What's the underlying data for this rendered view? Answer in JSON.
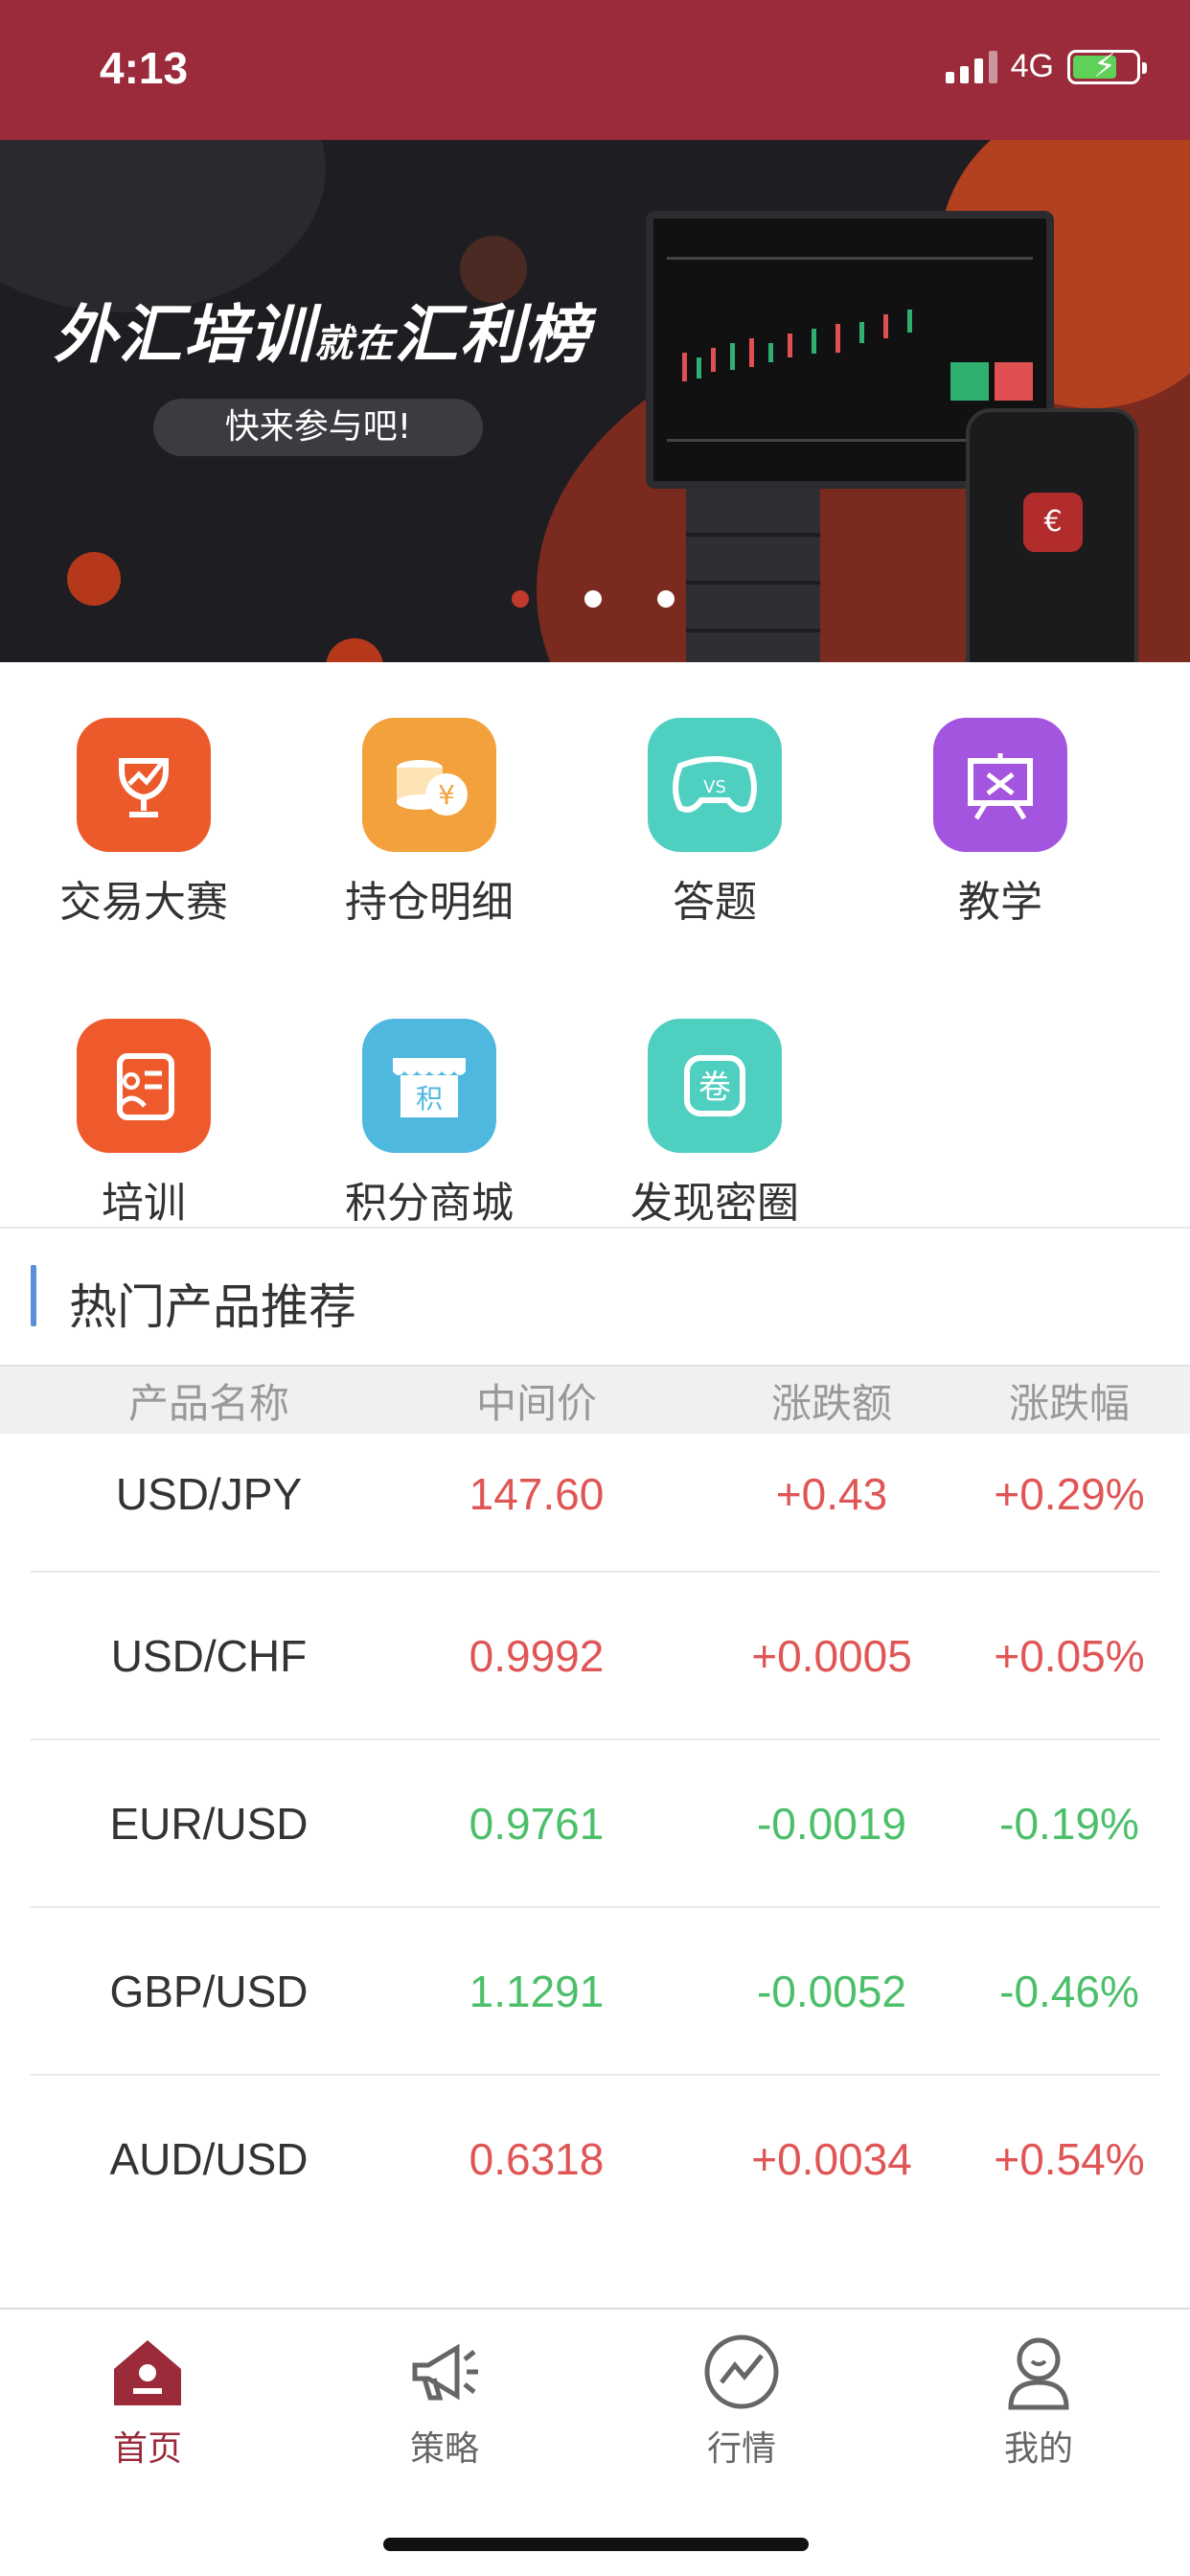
{
  "status_bar": {
    "time": "4:13",
    "network": "4G"
  },
  "banner": {
    "title_part1": "外汇培训",
    "title_small": "就在",
    "title_part2": "汇利榜",
    "pill_text": "快来参与吧!",
    "page_count": 3,
    "active_index": 0
  },
  "menu": {
    "items": [
      {
        "label": "交易大赛",
        "icon": "trophy-chart-icon",
        "color": "#ec5a2c"
      },
      {
        "label": "持仓明细",
        "icon": "coins-yen-icon",
        "color": "#f3a13c"
      },
      {
        "label": "答题",
        "icon": "gamepad-vs-icon",
        "color": "#4fcfc0"
      },
      {
        "label": "教学",
        "icon": "presentation-board-icon",
        "color": "#a355e0"
      },
      {
        "label": "培训",
        "icon": "certificate-icon",
        "color": "#ee5a2c"
      },
      {
        "label": "积分商城",
        "icon": "store-points-icon",
        "color": "#4fb8de"
      },
      {
        "label": "发现密圈",
        "icon": "circle-scroll-icon",
        "color": "#4fcfc0"
      }
    ]
  },
  "section": {
    "title": "热门产品推荐"
  },
  "table": {
    "headers": [
      "产品名称",
      "中间价",
      "涨跌额",
      "涨跌幅"
    ],
    "rows": [
      {
        "name": "USD/JPY",
        "mid": "147.60",
        "change": "+0.43",
        "pct": "+0.29%",
        "trend": "up"
      },
      {
        "name": "USD/CHF",
        "mid": "0.9992",
        "change": "+0.0005",
        "pct": "+0.05%",
        "trend": "up"
      },
      {
        "name": "EUR/USD",
        "mid": "0.9761",
        "change": "-0.0019",
        "pct": "-0.19%",
        "trend": "down"
      },
      {
        "name": "GBP/USD",
        "mid": "1.1291",
        "change": "-0.0052",
        "pct": "-0.46%",
        "trend": "down"
      },
      {
        "name": "AUD/USD",
        "mid": "0.6318",
        "change": "+0.0034",
        "pct": "+0.54%",
        "trend": "up"
      }
    ]
  },
  "tabbar": {
    "active": 0,
    "tabs": [
      {
        "label": "首页",
        "icon": "home-icon"
      },
      {
        "label": "策略",
        "icon": "megaphone-icon"
      },
      {
        "label": "行情",
        "icon": "market-chart-icon"
      },
      {
        "label": "我的",
        "icon": "user-icon"
      }
    ]
  },
  "colors": {
    "brand": "#9b2a3a",
    "up": "#e05555",
    "down": "#4cbf6a",
    "section_bar": "#5b8fd6"
  }
}
